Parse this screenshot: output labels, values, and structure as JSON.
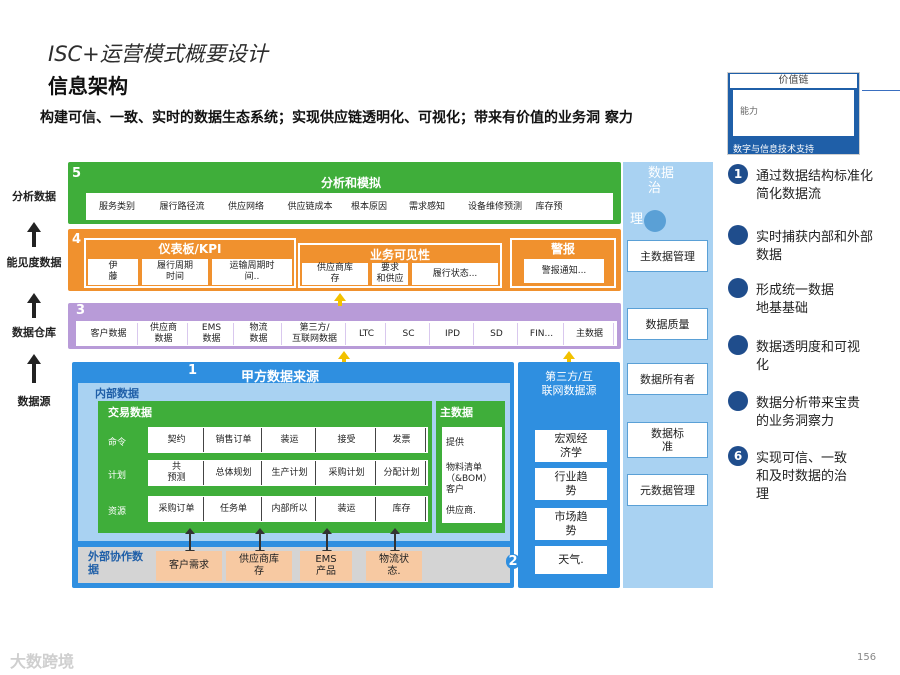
{
  "header": {
    "super_title": "ISC+运营模式概要设计",
    "title": "信息架构",
    "subtitle": "构建可信、一致、实时的数据生态系统；实现供应链透明化、可视化；带来有价值的业务洞 察力"
  },
  "thumbnail": {
    "top_label": "价值链",
    "inner_label": "能力",
    "caption": "数字与信息技术支持"
  },
  "side_labels": [
    "分析数据",
    "能见度数据",
    "数据仓库",
    "数据源"
  ],
  "layer5": {
    "num": "5",
    "title": "分析和模拟",
    "cells": [
      "服务类别",
      "履行路径流",
      "供应网络",
      "供应链成本",
      "根本原因",
      "需求感知",
      "设备维修预测",
      "库存预"
    ]
  },
  "layer4": {
    "num": "4",
    "kpi_title": "仪表板/KPI",
    "kpi_cells": [
      "伊\n藤",
      "履行周期\n时间",
      "运输周期时\n间.."
    ],
    "vis_title": "业务可见性",
    "vis_cells": [
      "供应商库\n存",
      "要求\n和供应",
      "履行状态..."
    ],
    "alert_title": "警报",
    "alert_cells": [
      "警报通知..."
    ]
  },
  "layer3": {
    "num": "3",
    "cells": [
      "客户数据",
      "供应商\n数据",
      "EMS\n数据",
      "物流\n数据",
      "第三方/\n互联网数据",
      "LTC",
      "SC",
      "IPD",
      "SD",
      "FIN...",
      "主数据"
    ]
  },
  "layer1": {
    "num": "1",
    "title": "甲方数据来源",
    "internal_label": "内部数据",
    "trade_label": "交易数据",
    "master_label": "主数据",
    "rows": [
      {
        "label": "命令",
        "cells": [
          "契约",
          "销售订单",
          "装运",
          "接受",
          "发票"
        ]
      },
      {
        "label": "计划",
        "cells": [
          "共\n预测",
          "总体规划",
          "生产计划",
          "采购计划",
          "分配计划"
        ]
      },
      {
        "label": "资源",
        "cells": [
          "采购订单",
          "任务单",
          "内部所以",
          "装运",
          "库存"
        ]
      }
    ],
    "master_items": [
      "提供",
      "物料清单\n（&BOM）\n客户",
      "供应商."
    ],
    "external_label": "外部协作数\n据",
    "external_items": [
      "客户需求",
      "供应商库\n存",
      "EMS\n产品",
      "物流状\n态."
    ]
  },
  "layer2": {
    "num": "2",
    "title": "第三方/互\n联网数据源",
    "items": [
      "宏观经\n济学",
      "行业趋\n势",
      "市场趋\n势",
      "天气."
    ]
  },
  "governance": {
    "title": "数据\n治",
    "title2": "理",
    "items": [
      "主数据管理",
      "数据质量",
      "数据所有者",
      "数据标\n准",
      "元数据管理"
    ]
  },
  "benefits": [
    {
      "num": "1",
      "text": "通过数据结构标准化\n简化数据流"
    },
    {
      "num": "",
      "text": "实时捕获内部和外部\n数据"
    },
    {
      "num": "",
      "text": "形成统一数据\n地基基础"
    },
    {
      "num": "",
      "text": "数据透明度和可视\n化"
    },
    {
      "num": "",
      "text": "数据分析带来宝贵\n的业务洞察力"
    },
    {
      "num": "6",
      "text": "实现可信、一致\n和及时数据的治\n理"
    }
  ],
  "footer": {
    "logo": "大数跨境",
    "page": "156"
  },
  "colors": {
    "green": "#3fae3a",
    "orange": "#f0912e",
    "purple": "#b89bd8",
    "blue": "#2f8fe0",
    "light_blue": "#a9d2f2",
    "navy": "#1f4d8c"
  }
}
